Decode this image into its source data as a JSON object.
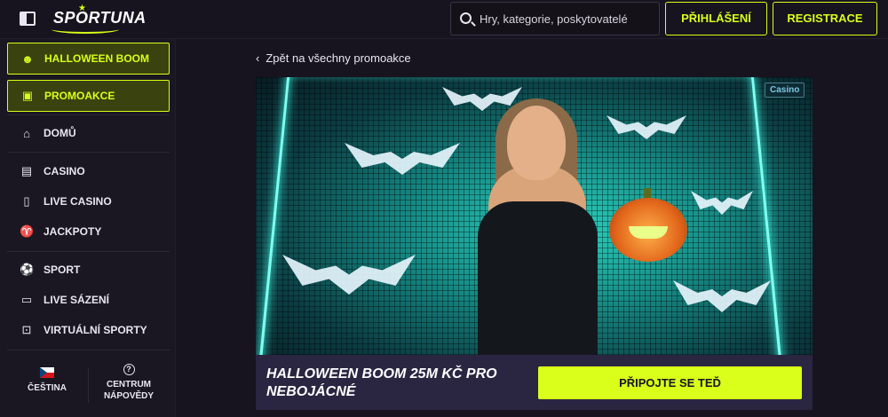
{
  "header": {
    "logo_text": "SPORTUNA",
    "search": {
      "placeholder": "Hry, kategorie, poskytovatelé"
    },
    "login_label": "PŘIHLÁŠENÍ",
    "register_label": "REGISTRACE"
  },
  "sidebar": {
    "items": [
      {
        "label": "HALLOWEEN BOOM",
        "icon": "pumpkin-icon",
        "active": true
      },
      {
        "label": "PROMOAKCE",
        "icon": "gift-icon",
        "active": true
      },
      {
        "label": "DOMŮ",
        "icon": "home-icon",
        "active": false
      },
      {
        "label": "CASINO",
        "icon": "casino-icon",
        "active": false
      },
      {
        "label": "LIVE CASINO",
        "icon": "card-icon",
        "active": false
      },
      {
        "label": "JACKPOTY",
        "icon": "jackpot-icon",
        "active": false
      },
      {
        "label": "SPORT",
        "icon": "soccer-ball-icon",
        "active": false
      },
      {
        "label": "LIVE SÁZENÍ",
        "icon": "live-camera-icon",
        "active": false
      },
      {
        "label": "VIRTUÁLNÍ SPORTY",
        "icon": "gamepad-icon",
        "active": false
      }
    ],
    "language_label": "ČEŠTINA",
    "help_label": "CENTRUM NÁPOVĚDY"
  },
  "main": {
    "back_link": "Zpět na všechny promoakce",
    "banner": {
      "category_badge": "Casino"
    },
    "promo": {
      "title": "HALLOWEEN BOOM 25M KČ PRO NEBOJÁCNÉ",
      "cta_label": "PŘIPOJTE SE TEĎ"
    }
  },
  "colors": {
    "background": "#17141f",
    "accent": "#d9ff1a",
    "promo_bar": "#2a2541"
  }
}
